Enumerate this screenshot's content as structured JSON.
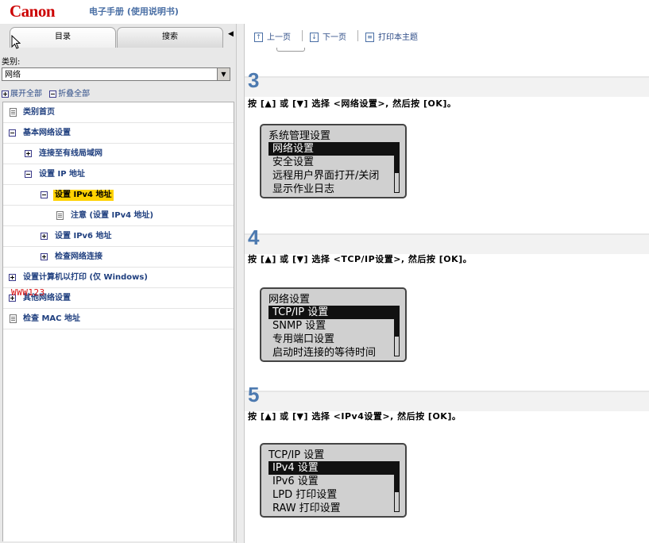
{
  "header": {
    "logo": "Canon",
    "subtitle": "电子手册 (使用说明书)"
  },
  "tabs": [
    {
      "label": "目录",
      "active": true
    },
    {
      "label": "搜索",
      "active": false
    }
  ],
  "category": {
    "label": "类别:",
    "value": "网络"
  },
  "tree_controls": {
    "expand_all": "展开全部",
    "collapse_all": "折叠全部"
  },
  "tree": [
    {
      "label": "类别首页",
      "icon": "doc-icon",
      "level": 0
    },
    {
      "label": "基本网络设置",
      "icon": "minus-icon",
      "level": 0
    },
    {
      "label": "连接至有线局域网",
      "icon": "plus-icon",
      "level": 1
    },
    {
      "label": "设置 IP 地址",
      "icon": "minus-icon",
      "level": 1
    },
    {
      "label": "设置 IPv4 地址",
      "icon": "minus-icon",
      "level": 2,
      "selected": true
    },
    {
      "label": "注意 (设置 IPv4 地址)",
      "icon": "doc-icon",
      "level": 3
    },
    {
      "label": "设置 IPv6 地址",
      "icon": "plus-icon",
      "level": 2
    },
    {
      "label": "检查网络连接",
      "icon": "plus-icon",
      "level": 2
    },
    {
      "label": "设置计算机以打印 (仅 Windows)",
      "icon": "plus-icon",
      "level": 0
    },
    {
      "label": "其他网络设置",
      "icon": "plus-icon",
      "level": 0
    },
    {
      "label": "检查 MAC 地址",
      "icon": "doc-icon",
      "level": 0
    }
  ],
  "watermark": "WWW123",
  "toolbar": {
    "prev": "上一页",
    "next": "下一页",
    "print": "打印本主题"
  },
  "steps": [
    {
      "number": "3",
      "instruction": "按 [▲] 或 [▼] 选择 <网络设置>, 然后按 [OK]。",
      "lcd_title": "系统管理设置",
      "lcd_items": [
        "网络设置",
        "安全设置",
        "远程用户界面打开/关闭",
        "显示作业日志"
      ],
      "selected_index": 0
    },
    {
      "number": "4",
      "instruction": "按 [▲] 或 [▼] 选择 <TCP/IP设置>, 然后按 [OK]。",
      "lcd_title": "网络设置",
      "lcd_items": [
        "TCP/IP 设置",
        "SNMP 设置",
        "专用端口设置",
        "启动时连接的等待时间"
      ],
      "selected_index": 0
    },
    {
      "number": "5",
      "instruction": "按 [▲] 或 [▼] 选择 <IPv4设置>, 然后按 [OK]。",
      "lcd_title": "TCP/IP 设置",
      "lcd_items": [
        "IPv4 设置",
        "IPv6 设置",
        "LPD 打印设置",
        "RAW 打印设置"
      ],
      "selected_index": 0
    }
  ],
  "colors": {
    "brand": "#cc0000",
    "link": "#1f3f7f",
    "highlight": "#ffd200",
    "step_number": "#4d7ab0"
  }
}
